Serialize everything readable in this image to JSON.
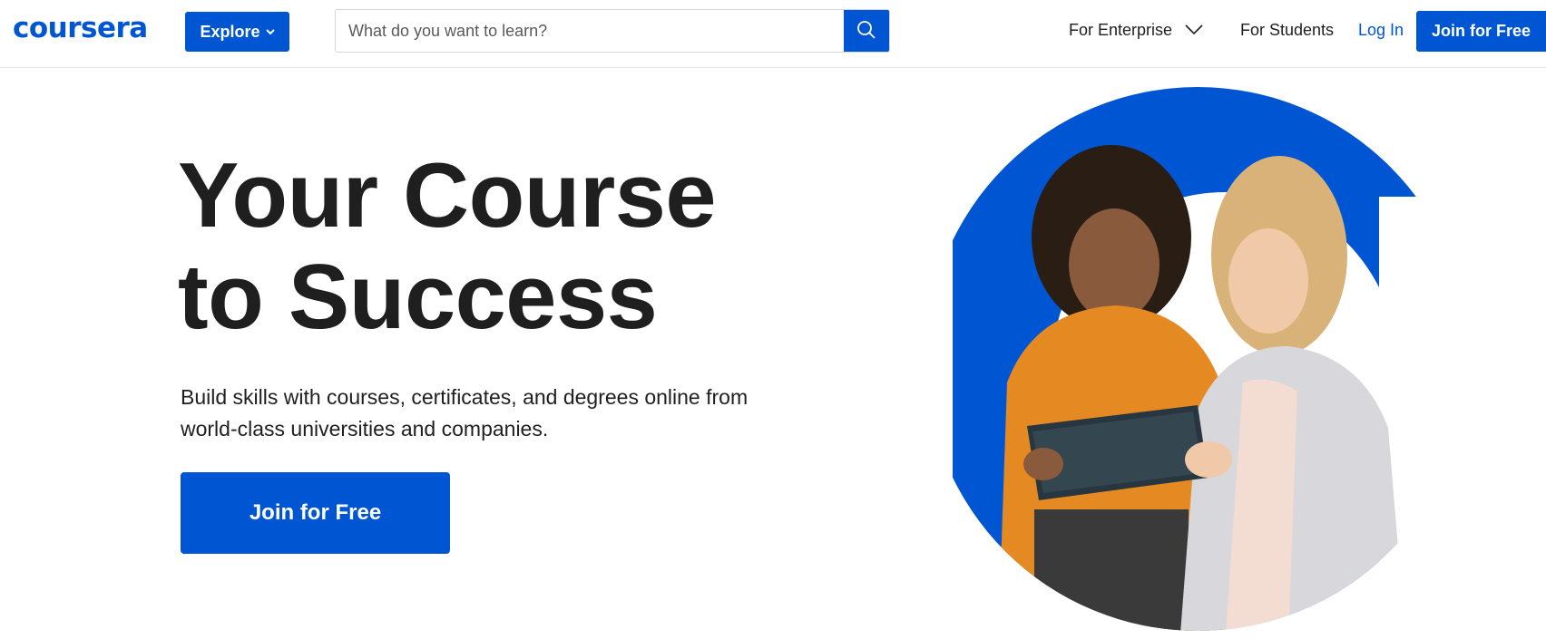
{
  "header": {
    "logo_text": "coursera",
    "explore_label": "Explore",
    "search": {
      "placeholder": "What do you want to learn?"
    },
    "nav": {
      "enterprise_label": "For Enterprise",
      "students_label": "For Students",
      "login_label": "Log In",
      "join_label": "Join for Free"
    }
  },
  "hero": {
    "title_line1": "Your Course",
    "title_line2": "to Success",
    "subtitle": "Build skills with courses, certificates, and degrees online from world-class universities and companies.",
    "cta_label": "Join for Free"
  },
  "colors": {
    "brand_blue": "#0056d2",
    "text_dark": "#1f1f1f"
  },
  "icons": {
    "search": "search-icon",
    "explore_chevron": "chevron-down-icon",
    "enterprise_chevron": "chevron-down-icon"
  }
}
